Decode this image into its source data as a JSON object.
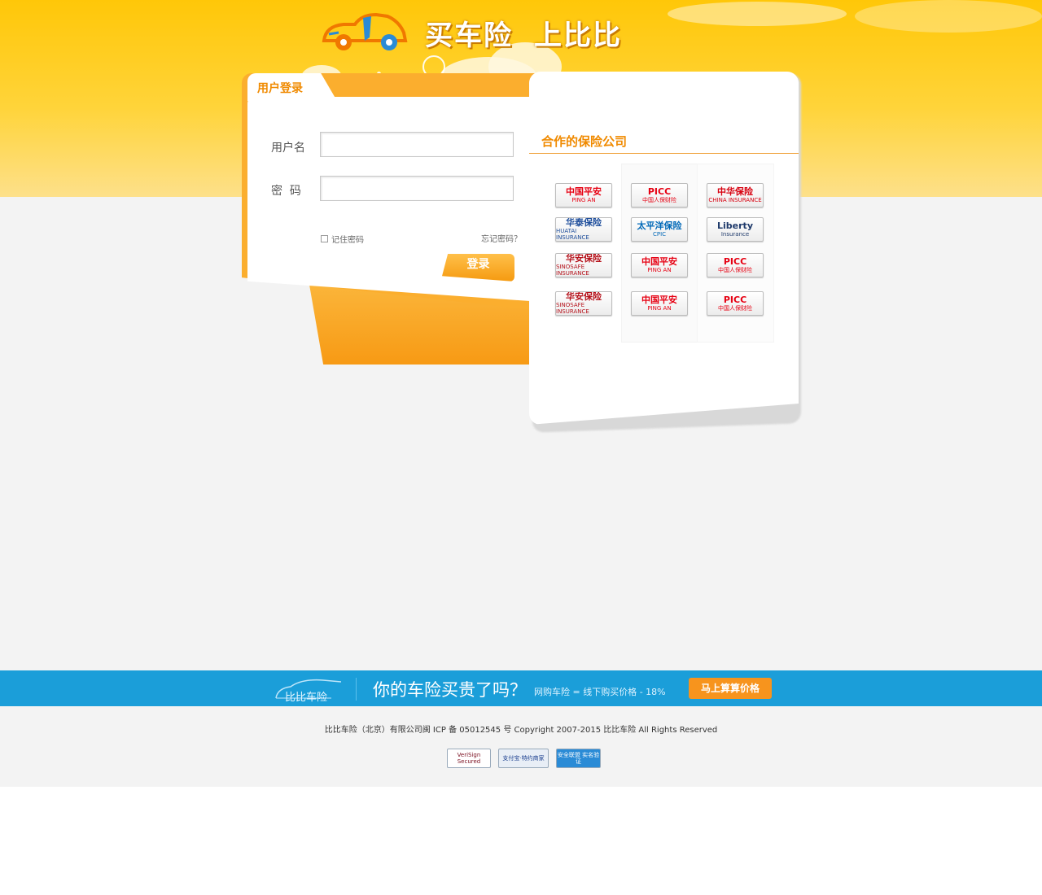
{
  "header": {
    "slogan_part1": "买车险",
    "slogan_part2": "上比比"
  },
  "login": {
    "tab_title": "用户登录",
    "username_label": "用户名",
    "username_value": "",
    "password_label": "密  码",
    "password_value": "",
    "remember_label": "记住密码",
    "remember_checked": false,
    "forgot_link": "忘记密码？",
    "submit_label": "登录"
  },
  "partners": {
    "title": "合作的保险公司",
    "logos": [
      {
        "name": "pingan-logo",
        "main": "中国平安",
        "sub": "PING AN",
        "color": "#e60012"
      },
      {
        "name": "picc-logo",
        "main": "PICC",
        "sub": "中国人保财险",
        "color": "#e60012"
      },
      {
        "name": "china-insurance-logo",
        "main": "中华保险",
        "sub": "CHINA INSURANCE",
        "color": "#d7000f"
      },
      {
        "name": "huatai-logo",
        "main": "华泰保险",
        "sub": "HUATAI INSURANCE",
        "color": "#1f4e9b"
      },
      {
        "name": "cpic-logo",
        "main": "太平洋保险",
        "sub": "CPIC",
        "color": "#0068b7"
      },
      {
        "name": "liberty-logo",
        "main": "Liberty",
        "sub": "Insurance",
        "color": "#1f3a6b"
      },
      {
        "name": "sinosafe-logo",
        "main": "华安保险",
        "sub": "SINOSAFE INSURANCE",
        "color": "#b5121b"
      },
      {
        "name": "pingan-logo-2",
        "main": "中国平安",
        "sub": "PING AN",
        "color": "#e60012"
      },
      {
        "name": "picc-logo-2",
        "main": "PICC",
        "sub": "中国人保财险",
        "color": "#e60012"
      },
      {
        "name": "sinosafe-logo-2",
        "main": "华安保险",
        "sub": "SINOSAFE INSURANCE",
        "color": "#b5121b"
      },
      {
        "name": "pingan-logo-3",
        "main": "中国平安",
        "sub": "PING AN",
        "color": "#e60012"
      },
      {
        "name": "picc-logo-3",
        "main": "PICC",
        "sub": "中国人保财险",
        "color": "#e60012"
      }
    ]
  },
  "banner": {
    "logo_text": "比比车险",
    "question": "你的车险买贵了吗？",
    "formula": "网购车险 = 线下购买价格 - 18%",
    "cta": "马上算算价格"
  },
  "footer": {
    "copyright": "比比车险（北京）有限公司闽 ICP 备 05012545 号 Copyright 2007-2015 比比车险  All Rights Reserved",
    "badges": [
      {
        "name": "verisign-badge",
        "text": "VeriSign Secured",
        "bg": "#ffffff",
        "color": "#7a0d1e"
      },
      {
        "name": "alipay-badge",
        "text": "支付宝·特约商家",
        "bg": "#e8eef6",
        "color": "#1b3f8f"
      },
      {
        "name": "safety-alliance-badge",
        "text": "安全联盟 实名验证",
        "bg": "#2a8bd6",
        "color": "#ffffff"
      }
    ]
  },
  "colors": {
    "accent_orange": "#f08a00",
    "banner_blue": "#1b9ed9",
    "sky_yellow": "#ffc708"
  }
}
